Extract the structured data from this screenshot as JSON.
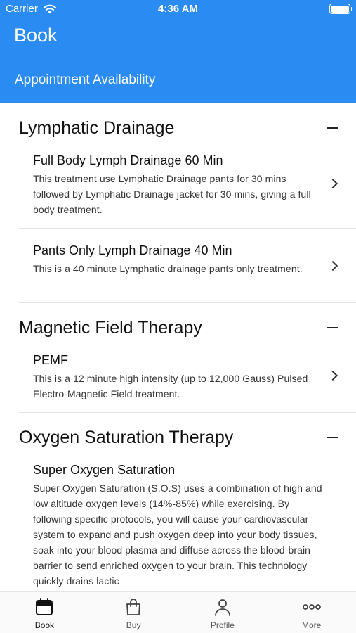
{
  "status_bar": {
    "carrier": "Carrier",
    "time": "4:36 AM"
  },
  "header": {
    "title": "Book",
    "subtitle": "Appointment Availability"
  },
  "sections": [
    {
      "title": "Lymphatic Drainage",
      "items": [
        {
          "title": "Full Body Lymph Drainage 60 Min",
          "description": "This treatment use Lymphatic Drainage pants for 30 mins followed by Lymphatic Drainage jacket for 30 mins, giving a full body treatment."
        },
        {
          "title": "Pants Only Lymph Drainage 40 Min",
          "description": "This is a 40 minute Lymphatic drainage pants only treatment."
        }
      ]
    },
    {
      "title": "Magnetic Field Therapy",
      "items": [
        {
          "title": "PEMF",
          "description": "This is a 12 minute high intensity (up to 12,000 Gauss) Pulsed Electro-Magnetic Field treatment."
        }
      ]
    },
    {
      "title": "Oxygen Saturation Therapy",
      "items": [
        {
          "title": "Super Oxygen Saturation",
          "description": "Super Oxygen Saturation (S.O.S) uses a combination of high and low altitude oxygen levels (14%-85%) while exercising. By following specific protocols, you will cause your cardiovascular system to expand and push oxygen deep into your body tissues, soak into your blood plasma and diffuse across the blood-brain barrier to send enriched oxygen to your brain.    This technology quickly drains lactic"
        }
      ]
    }
  ],
  "tabs": [
    {
      "label": "Book",
      "icon": "calendar-icon",
      "active": true
    },
    {
      "label": "Buy",
      "icon": "shopping-bag-icon",
      "active": false
    },
    {
      "label": "Profile",
      "icon": "person-icon",
      "active": false
    },
    {
      "label": "More",
      "icon": "more-dots-icon",
      "active": false
    }
  ],
  "colors": {
    "header": "#2a8cf3",
    "header_text": "#ffffff"
  }
}
